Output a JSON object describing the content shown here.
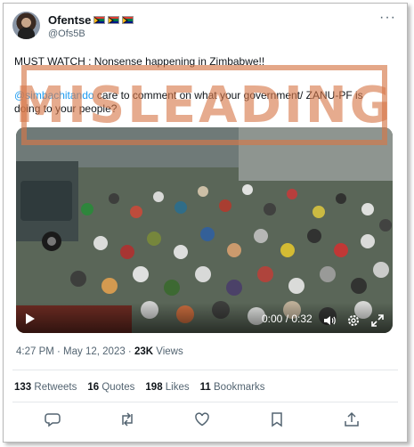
{
  "tweet": {
    "author_name": "Ofentse",
    "author_handle": "@Ofs5B",
    "text_line1": "MUST WATCH : Nonsense happening in Zimbabwe!!",
    "mention": "@simbachitando",
    "text_line2_rest": " care to comment on what your government/ ZANU-PF is doing to your people?",
    "stamp_label": "MISLEADING",
    "video": {
      "current_time": "0:00",
      "separator": " / ",
      "duration": "0:32"
    },
    "posted_time": "4:27 PM · May 12, 2023 · ",
    "views_count": "23K",
    "views_label": " Views",
    "stats": {
      "retweets_count": "133",
      "retweets_label": " Retweets",
      "quotes_count": "16",
      "quotes_label": " Quotes",
      "likes_count": "198",
      "likes_label": " Likes",
      "bookmarks_count": "11",
      "bookmarks_label": " Bookmarks"
    }
  },
  "colors": {
    "link": "#1d9bf0",
    "secondary_text": "#536471",
    "stamp": "#d67848"
  },
  "icons": [
    "more-icon",
    "play-icon",
    "volume-icon",
    "settings-gear-icon",
    "fullscreen-icon",
    "reply-icon",
    "retweet-icon",
    "like-heart-icon",
    "bookmark-icon",
    "share-icon"
  ]
}
